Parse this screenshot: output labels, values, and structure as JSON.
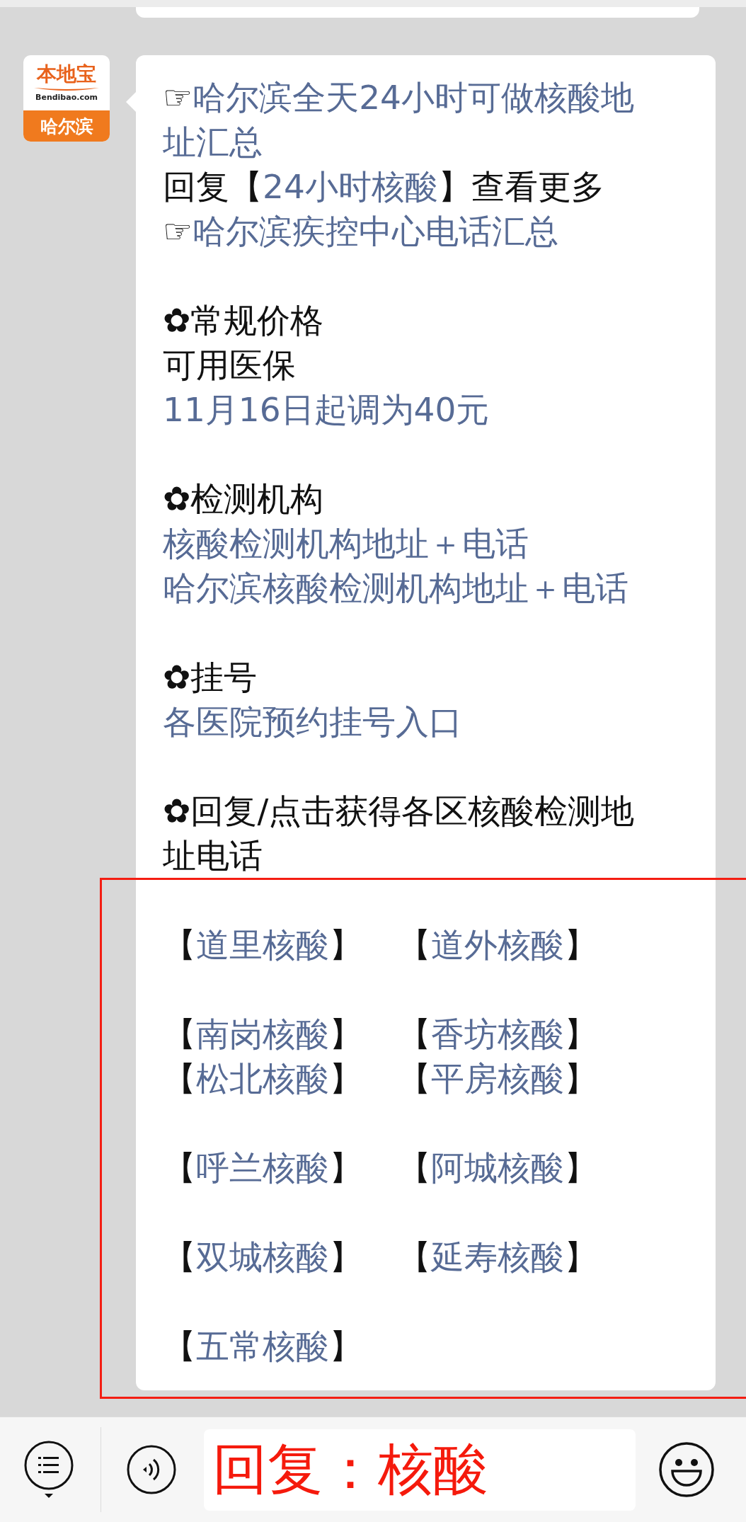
{
  "message": {
    "avatar": {
      "brand": "本地宝",
      "domain": "Bendibao.com",
      "city": "哈尔滨"
    },
    "paragraphs": [
      {
        "lines": [
          [
            {
              "text": "☞",
              "link": false
            },
            {
              "text": "哈尔滨全天24小时可做核酸地",
              "link": true
            }
          ],
          [
            {
              "text": "址汇总",
              "link": true
            }
          ],
          [
            {
              "text": "回复【",
              "link": false
            },
            {
              "text": "24小时核酸",
              "link": true
            },
            {
              "text": "】查看更多",
              "link": false
            }
          ],
          [
            {
              "text": "☞",
              "link": false
            },
            {
              "text": "哈尔滨疾控中心电话汇总",
              "link": true
            }
          ]
        ]
      },
      {
        "lines": [
          [
            {
              "text": "✿常规价格",
              "link": false
            }
          ],
          [
            {
              "text": "可用医保",
              "link": false
            }
          ],
          [
            {
              "text": "11月16日起调为40元",
              "link": true
            }
          ]
        ]
      },
      {
        "lines": [
          [
            {
              "text": "✿检测机构",
              "link": false
            }
          ],
          [
            {
              "text": "核酸检测机构地址＋电话",
              "link": true
            }
          ],
          [
            {
              "text": "哈尔滨核酸检测机构地址＋电话",
              "link": true
            }
          ]
        ]
      },
      {
        "lines": [
          [
            {
              "text": "✿挂号",
              "link": false
            }
          ],
          [
            {
              "text": "各医院预约挂号入口",
              "link": true
            }
          ]
        ]
      },
      {
        "lines": [
          [
            {
              "text": "✿回复/点击获得各区核酸检测地",
              "link": false
            }
          ],
          [
            {
              "text": "址电话",
              "link": false
            }
          ]
        ]
      }
    ],
    "district_groups": [
      [
        [
          {
            "open": "【",
            "label": "道里核酸",
            "close": "】"
          },
          {
            "open": "【",
            "label": "道外核酸",
            "close": "】"
          }
        ]
      ],
      [
        [
          {
            "open": "【",
            "label": "南岗核酸",
            "close": "】"
          },
          {
            "open": "【",
            "label": "香坊核酸",
            "close": "】"
          }
        ],
        [
          {
            "open": "【",
            "label": "松北核酸",
            "close": "】"
          },
          {
            "open": "【",
            "label": "平房核酸",
            "close": "】"
          }
        ]
      ],
      [
        [
          {
            "open": "【",
            "label": "呼兰核酸",
            "close": "】"
          },
          {
            "open": "【",
            "label": "阿城核酸",
            "close": "】"
          }
        ]
      ],
      [
        [
          {
            "open": "【",
            "label": "双城核酸",
            "close": "】"
          },
          {
            "open": "【",
            "label": "延寿核酸",
            "close": "】"
          }
        ]
      ],
      [
        [
          {
            "open": "【",
            "label": "五常核酸",
            "close": "】"
          }
        ]
      ]
    ]
  },
  "input_bar": {
    "value": "回复：核酸"
  }
}
